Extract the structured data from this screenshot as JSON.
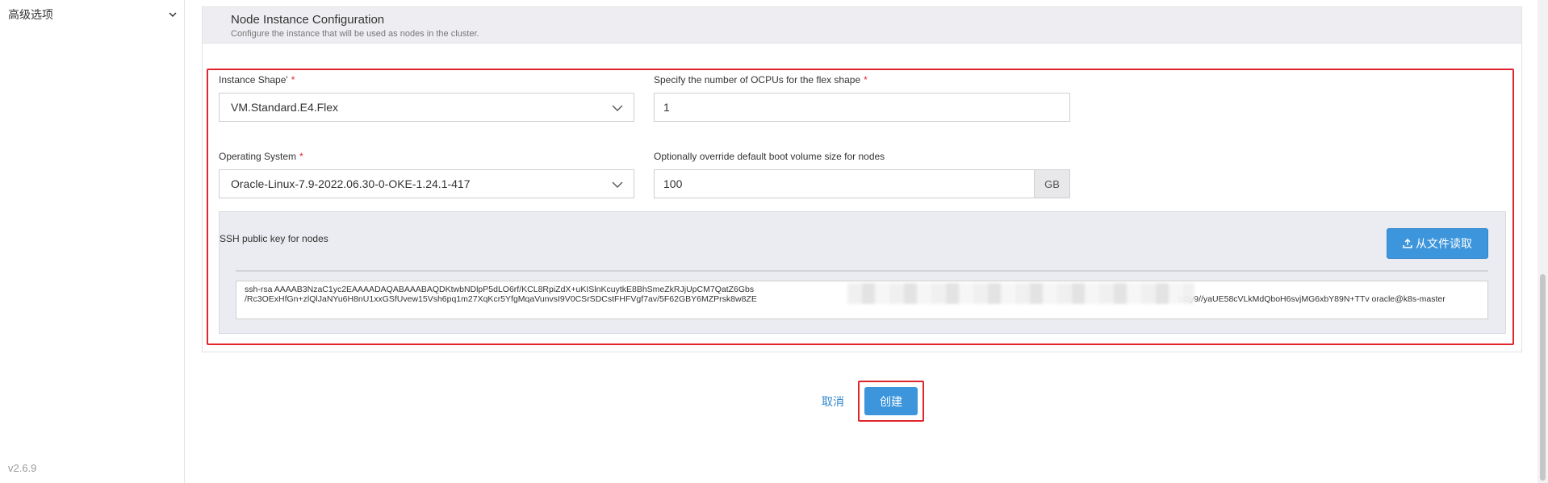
{
  "sidebar": {
    "advanced_options_label": "高级选项",
    "version": "v2.6.9"
  },
  "panel": {
    "title": "Node Instance Configuration",
    "description": "Configure the instance that will be used as nodes in the cluster."
  },
  "form": {
    "instance_shape": {
      "label": "Instance Shape'",
      "required_mark": "*",
      "value": "VM.Standard.E4.Flex"
    },
    "ocpus": {
      "label": "Specify the number of OCPUs for the flex shape",
      "required_mark": "*",
      "value": "1"
    },
    "operating_system": {
      "label": "Operating System",
      "required_mark": "*",
      "value": "Oracle-Linux-7.9-2022.06.30-0-OKE-1.24.1-417"
    },
    "boot_volume": {
      "label": "Optionally override default boot volume size for nodes",
      "value": "100",
      "unit": "GB"
    },
    "ssh": {
      "label": "SSH public key for nodes",
      "read_file_button": "从文件读取",
      "key_text_part1": "ssh-rsa AAAAB3NzaC1yc2EAAAADAQABAAABAQDKtwbNDlpP5dLO6rf/KCL8RpiZdX+uKISlnKcuytkE8BhSmeZkRJjUpCM7QatZ6Gbs",
      "key_text_part2": "bGy9//yaUE58cVLkMdQboH6svjMG6xbY89N+TTv oracle@k8s-master",
      "key_line2_start": "/Rc3OExHfGn+zlQlJaNYu6H8nU1xxGSfUvew15Vsh6pq1m27XqKcr5YfgMqaVunvsI9V0CSrSDCstFHFVgf7av/5F62GBY6MZPrsk8w8ZE"
    }
  },
  "actions": {
    "cancel": "取消",
    "create": "创建"
  },
  "colors": {
    "primary": "#3d96dc",
    "highlight_red": "#e0242c",
    "required": "#e0242c",
    "header_bg": "#eeeef2"
  }
}
